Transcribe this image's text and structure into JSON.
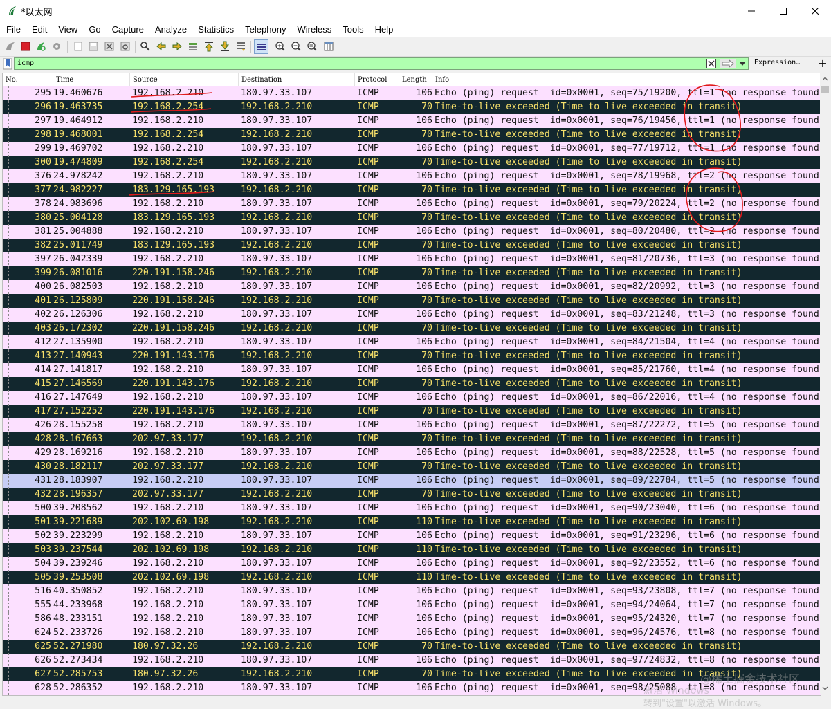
{
  "window": {
    "title": "*以太网"
  },
  "menu": [
    "File",
    "Edit",
    "View",
    "Go",
    "Capture",
    "Analyze",
    "Statistics",
    "Telephony",
    "Wireless",
    "Tools",
    "Help"
  ],
  "filter": {
    "value": "icmp",
    "expression_label": "Expression…",
    "plus_label": "+"
  },
  "columns": {
    "no": "No.",
    "time": "Time",
    "source": "Source",
    "destination": "Destination",
    "protocol": "Protocol",
    "length": "Length",
    "info": "Info"
  },
  "packets": [
    {
      "no": "295",
      "time": "19.460676",
      "src": "192.168.2.210",
      "dst": "180.97.33.107",
      "proto": "ICMP",
      "len": "106",
      "info": "Echo (ping) request  id=0x0001, seq=75/19200, ttl=1 (no response found",
      "kind": "echo"
    },
    {
      "no": "296",
      "time": "19.463735",
      "src": "192.168.2.254",
      "dst": "192.168.2.210",
      "proto": "ICMP",
      "len": "70",
      "info": "Time-to-live exceeded (Time to live exceeded in transit)",
      "kind": "exceeded"
    },
    {
      "no": "297",
      "time": "19.464912",
      "src": "192.168.2.210",
      "dst": "180.97.33.107",
      "proto": "ICMP",
      "len": "106",
      "info": "Echo (ping) request  id=0x0001, seq=76/19456, ttl=1 (no response found",
      "kind": "echo"
    },
    {
      "no": "298",
      "time": "19.468001",
      "src": "192.168.2.254",
      "dst": "192.168.2.210",
      "proto": "ICMP",
      "len": "70",
      "info": "Time-to-live exceeded (Time to live exceeded in transit)",
      "kind": "exceeded"
    },
    {
      "no": "299",
      "time": "19.469702",
      "src": "192.168.2.210",
      "dst": "180.97.33.107",
      "proto": "ICMP",
      "len": "106",
      "info": "Echo (ping) request  id=0x0001, seq=77/19712, ttl=1 (no response found",
      "kind": "echo"
    },
    {
      "no": "300",
      "time": "19.474809",
      "src": "192.168.2.254",
      "dst": "192.168.2.210",
      "proto": "ICMP",
      "len": "70",
      "info": "Time-to-live exceeded (Time to live exceeded in transit)",
      "kind": "exceeded"
    },
    {
      "no": "376",
      "time": "24.978242",
      "src": "192.168.2.210",
      "dst": "180.97.33.107",
      "proto": "ICMP",
      "len": "106",
      "info": "Echo (ping) request  id=0x0001, seq=78/19968, ttl=2 (no response found",
      "kind": "echo"
    },
    {
      "no": "377",
      "time": "24.982227",
      "src": "183.129.165.193",
      "dst": "192.168.2.210",
      "proto": "ICMP",
      "len": "70",
      "info": "Time-to-live exceeded (Time to live exceeded in transit)",
      "kind": "exceeded"
    },
    {
      "no": "378",
      "time": "24.983696",
      "src": "192.168.2.210",
      "dst": "180.97.33.107",
      "proto": "ICMP",
      "len": "106",
      "info": "Echo (ping) request  id=0x0001, seq=79/20224, ttl=2 (no response found",
      "kind": "echo"
    },
    {
      "no": "380",
      "time": "25.004128",
      "src": "183.129.165.193",
      "dst": "192.168.2.210",
      "proto": "ICMP",
      "len": "70",
      "info": "Time-to-live exceeded (Time to live exceeded in transit)",
      "kind": "exceeded"
    },
    {
      "no": "381",
      "time": "25.004888",
      "src": "192.168.2.210",
      "dst": "180.97.33.107",
      "proto": "ICMP",
      "len": "106",
      "info": "Echo (ping) request  id=0x0001, seq=80/20480, ttl=2 (no response found",
      "kind": "echo"
    },
    {
      "no": "382",
      "time": "25.011749",
      "src": "183.129.165.193",
      "dst": "192.168.2.210",
      "proto": "ICMP",
      "len": "70",
      "info": "Time-to-live exceeded (Time to live exceeded in transit)",
      "kind": "exceeded"
    },
    {
      "no": "397",
      "time": "26.042339",
      "src": "192.168.2.210",
      "dst": "180.97.33.107",
      "proto": "ICMP",
      "len": "106",
      "info": "Echo (ping) request  id=0x0001, seq=81/20736, ttl=3 (no response found",
      "kind": "echo"
    },
    {
      "no": "399",
      "time": "26.081016",
      "src": "220.191.158.246",
      "dst": "192.168.2.210",
      "proto": "ICMP",
      "len": "70",
      "info": "Time-to-live exceeded (Time to live exceeded in transit)",
      "kind": "exceeded"
    },
    {
      "no": "400",
      "time": "26.082503",
      "src": "192.168.2.210",
      "dst": "180.97.33.107",
      "proto": "ICMP",
      "len": "106",
      "info": "Echo (ping) request  id=0x0001, seq=82/20992, ttl=3 (no response found",
      "kind": "echo"
    },
    {
      "no": "401",
      "time": "26.125809",
      "src": "220.191.158.246",
      "dst": "192.168.2.210",
      "proto": "ICMP",
      "len": "70",
      "info": "Time-to-live exceeded (Time to live exceeded in transit)",
      "kind": "exceeded"
    },
    {
      "no": "402",
      "time": "26.126306",
      "src": "192.168.2.210",
      "dst": "180.97.33.107",
      "proto": "ICMP",
      "len": "106",
      "info": "Echo (ping) request  id=0x0001, seq=83/21248, ttl=3 (no response found",
      "kind": "echo"
    },
    {
      "no": "403",
      "time": "26.172302",
      "src": "220.191.158.246",
      "dst": "192.168.2.210",
      "proto": "ICMP",
      "len": "70",
      "info": "Time-to-live exceeded (Time to live exceeded in transit)",
      "kind": "exceeded"
    },
    {
      "no": "412",
      "time": "27.135900",
      "src": "192.168.2.210",
      "dst": "180.97.33.107",
      "proto": "ICMP",
      "len": "106",
      "info": "Echo (ping) request  id=0x0001, seq=84/21504, ttl=4 (no response found",
      "kind": "echo"
    },
    {
      "no": "413",
      "time": "27.140943",
      "src": "220.191.143.176",
      "dst": "192.168.2.210",
      "proto": "ICMP",
      "len": "70",
      "info": "Time-to-live exceeded (Time to live exceeded in transit)",
      "kind": "exceeded"
    },
    {
      "no": "414",
      "time": "27.141817",
      "src": "192.168.2.210",
      "dst": "180.97.33.107",
      "proto": "ICMP",
      "len": "106",
      "info": "Echo (ping) request  id=0x0001, seq=85/21760, ttl=4 (no response found",
      "kind": "echo"
    },
    {
      "no": "415",
      "time": "27.146569",
      "src": "220.191.143.176",
      "dst": "192.168.2.210",
      "proto": "ICMP",
      "len": "70",
      "info": "Time-to-live exceeded (Time to live exceeded in transit)",
      "kind": "exceeded"
    },
    {
      "no": "416",
      "time": "27.147649",
      "src": "192.168.2.210",
      "dst": "180.97.33.107",
      "proto": "ICMP",
      "len": "106",
      "info": "Echo (ping) request  id=0x0001, seq=86/22016, ttl=4 (no response found",
      "kind": "echo"
    },
    {
      "no": "417",
      "time": "27.152252",
      "src": "220.191.143.176",
      "dst": "192.168.2.210",
      "proto": "ICMP",
      "len": "70",
      "info": "Time-to-live exceeded (Time to live exceeded in transit)",
      "kind": "exceeded"
    },
    {
      "no": "426",
      "time": "28.155258",
      "src": "192.168.2.210",
      "dst": "180.97.33.107",
      "proto": "ICMP",
      "len": "106",
      "info": "Echo (ping) request  id=0x0001, seq=87/22272, ttl=5 (no response found",
      "kind": "echo"
    },
    {
      "no": "428",
      "time": "28.167663",
      "src": "202.97.33.177",
      "dst": "192.168.2.210",
      "proto": "ICMP",
      "len": "70",
      "info": "Time-to-live exceeded (Time to live exceeded in transit)",
      "kind": "exceeded"
    },
    {
      "no": "429",
      "time": "28.169216",
      "src": "192.168.2.210",
      "dst": "180.97.33.107",
      "proto": "ICMP",
      "len": "106",
      "info": "Echo (ping) request  id=0x0001, seq=88/22528, ttl=5 (no response found",
      "kind": "echo"
    },
    {
      "no": "430",
      "time": "28.182117",
      "src": "202.97.33.177",
      "dst": "192.168.2.210",
      "proto": "ICMP",
      "len": "70",
      "info": "Time-to-live exceeded (Time to live exceeded in transit)",
      "kind": "exceeded"
    },
    {
      "no": "431",
      "time": "28.183907",
      "src": "192.168.2.210",
      "dst": "180.97.33.107",
      "proto": "ICMP",
      "len": "106",
      "info": "Echo (ping) request  id=0x0001, seq=89/22784, ttl=5 (no response found",
      "kind": "selected"
    },
    {
      "no": "432",
      "time": "28.196357",
      "src": "202.97.33.177",
      "dst": "192.168.2.210",
      "proto": "ICMP",
      "len": "70",
      "info": "Time-to-live exceeded (Time to live exceeded in transit)",
      "kind": "exceeded"
    },
    {
      "no": "500",
      "time": "39.208562",
      "src": "192.168.2.210",
      "dst": "180.97.33.107",
      "proto": "ICMP",
      "len": "106",
      "info": "Echo (ping) request  id=0x0001, seq=90/23040, ttl=6 (no response found",
      "kind": "echo"
    },
    {
      "no": "501",
      "time": "39.221689",
      "src": "202.102.69.198",
      "dst": "192.168.2.210",
      "proto": "ICMP",
      "len": "110",
      "info": "Time-to-live exceeded (Time to live exceeded in transit)",
      "kind": "exceeded"
    },
    {
      "no": "502",
      "time": "39.223299",
      "src": "192.168.2.210",
      "dst": "180.97.33.107",
      "proto": "ICMP",
      "len": "106",
      "info": "Echo (ping) request  id=0x0001, seq=91/23296, ttl=6 (no response found",
      "kind": "echo"
    },
    {
      "no": "503",
      "time": "39.237544",
      "src": "202.102.69.198",
      "dst": "192.168.2.210",
      "proto": "ICMP",
      "len": "110",
      "info": "Time-to-live exceeded (Time to live exceeded in transit)",
      "kind": "exceeded"
    },
    {
      "no": "504",
      "time": "39.239246",
      "src": "192.168.2.210",
      "dst": "180.97.33.107",
      "proto": "ICMP",
      "len": "106",
      "info": "Echo (ping) request  id=0x0001, seq=92/23552, ttl=6 (no response found",
      "kind": "echo"
    },
    {
      "no": "505",
      "time": "39.253508",
      "src": "202.102.69.198",
      "dst": "192.168.2.210",
      "proto": "ICMP",
      "len": "110",
      "info": "Time-to-live exceeded (Time to live exceeded in transit)",
      "kind": "exceeded"
    },
    {
      "no": "516",
      "time": "40.350852",
      "src": "192.168.2.210",
      "dst": "180.97.33.107",
      "proto": "ICMP",
      "len": "106",
      "info": "Echo (ping) request  id=0x0001, seq=93/23808, ttl=7 (no response found",
      "kind": "echo"
    },
    {
      "no": "555",
      "time": "44.233968",
      "src": "192.168.2.210",
      "dst": "180.97.33.107",
      "proto": "ICMP",
      "len": "106",
      "info": "Echo (ping) request  id=0x0001, seq=94/24064, ttl=7 (no response found",
      "kind": "echo"
    },
    {
      "no": "586",
      "time": "48.233151",
      "src": "192.168.2.210",
      "dst": "180.97.33.107",
      "proto": "ICMP",
      "len": "106",
      "info": "Echo (ping) request  id=0x0001, seq=95/24320, ttl=7 (no response found",
      "kind": "echo"
    },
    {
      "no": "624",
      "time": "52.233726",
      "src": "192.168.2.210",
      "dst": "180.97.33.107",
      "proto": "ICMP",
      "len": "106",
      "info": "Echo (ping) request  id=0x0001, seq=96/24576, ttl=8 (no response found",
      "kind": "echo"
    },
    {
      "no": "625",
      "time": "52.271980",
      "src": "180.97.32.26",
      "dst": "192.168.2.210",
      "proto": "ICMP",
      "len": "70",
      "info": "Time-to-live exceeded (Time to live exceeded in transit)",
      "kind": "exceeded"
    },
    {
      "no": "626",
      "time": "52.273434",
      "src": "192.168.2.210",
      "dst": "180.97.33.107",
      "proto": "ICMP",
      "len": "106",
      "info": "Echo (ping) request  id=0x0001, seq=97/24832, ttl=8 (no response found",
      "kind": "echo"
    },
    {
      "no": "627",
      "time": "52.285753",
      "src": "180.97.32.26",
      "dst": "192.168.2.210",
      "proto": "ICMP",
      "len": "70",
      "info": "Time-to-live exceeded (Time to live exceeded in transit)",
      "kind": "exceeded"
    },
    {
      "no": "628",
      "time": "52.286352",
      "src": "192.168.2.210",
      "dst": "180.97.33.107",
      "proto": "ICMP",
      "len": "106",
      "info": "Echo (ping) request  id=0x0001, seq=98/25088, ttl=8 (no response found",
      "kind": "echo"
    }
  ],
  "colors": {
    "echo_bg": "#fce0ff",
    "exceeded_bg": "#12272e",
    "exceeded_fg": "#f7e06a",
    "selected_bg": "#c7cdf5",
    "filter_ok": "#afffaf",
    "annotation": "#e0191b"
  },
  "watermark": {
    "line1": "@稀土掘金技术社区",
    "line2": "激活 Windows",
    "line3": "转到\"设置\"以激活 Windows。"
  }
}
